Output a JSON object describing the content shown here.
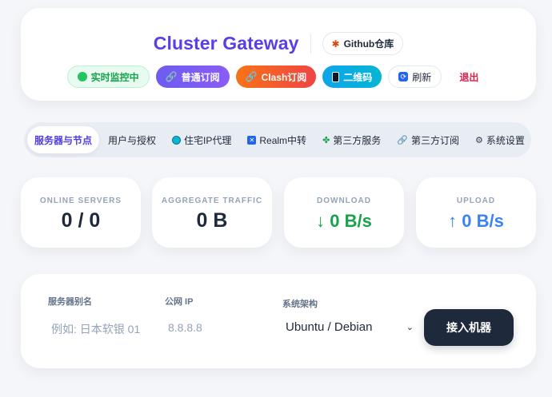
{
  "header": {
    "title": "Cluster Gateway",
    "github_label": "Github仓库",
    "actions": {
      "live_label": "实时监控中",
      "sub_label": "普通订阅",
      "clash_label": "Clash订阅",
      "qr_label": "二维码",
      "refresh_label": "刷新",
      "logout_label": "退出"
    }
  },
  "nav": {
    "tabs": [
      {
        "label": "服务器与节点",
        "icon": "none"
      },
      {
        "label": "用户与授权",
        "icon": "none"
      },
      {
        "label": "住宅IP代理",
        "icon": "globe-icon"
      },
      {
        "label": "Realm中转",
        "icon": "realm-icon"
      },
      {
        "label": "第三方服务",
        "icon": "clover-icon"
      },
      {
        "label": "第三方订阅",
        "icon": "link-icon"
      },
      {
        "label": "系统设置",
        "icon": "gear-icon"
      }
    ]
  },
  "stats": {
    "online": {
      "label": "ONLINE SERVERS",
      "value": "0 / 0"
    },
    "traffic": {
      "label": "AGGREGATE TRAFFIC",
      "value": "0 B"
    },
    "download": {
      "label": "DOWNLOAD",
      "value": "↓ 0 B/s"
    },
    "upload": {
      "label": "UPLOAD",
      "value": "↑ 0 B/s"
    }
  },
  "form": {
    "alias_label": "服务器别名",
    "alias_placeholder": "例如: 日本软银 01",
    "ip_label": "公网 IP",
    "ip_placeholder": "8.8.8.8",
    "arch_label": "系统架构",
    "arch_value": "Ubuntu / Debian",
    "connect_label": "接入机器"
  },
  "colors": {
    "accent": "#5b3ee6",
    "live_green": "#16a34a",
    "download_green": "#16a34a",
    "upload_blue": "#3b82f6",
    "logout_red": "#e11d48",
    "primary_dark": "#1e293b"
  }
}
